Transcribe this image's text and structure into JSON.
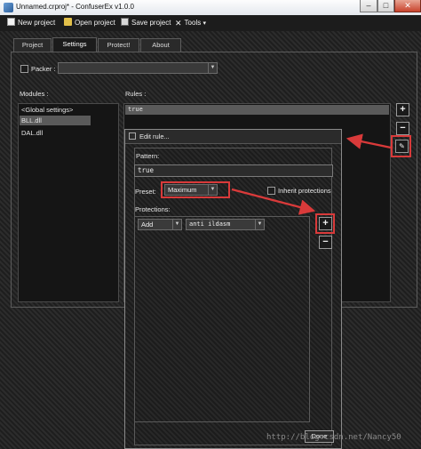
{
  "window": {
    "title": "Unnamed.crproj* - ConfuserEx v1.0.0",
    "minimize": "–",
    "maximize": "□",
    "close": "✕"
  },
  "toolbar": {
    "new_project": "New project",
    "open_project": "Open project",
    "save_project": "Save project",
    "tools": "Tools",
    "tools_caret": "▾"
  },
  "tabs": [
    "Project",
    "Settings",
    "Protect!",
    "About"
  ],
  "settings": {
    "packer_label": "Packer :",
    "modules_label": "Modules :",
    "rules_label": "Rules :",
    "modules": [
      "<Global settings>",
      "BLL.dll",
      "DAL.dll"
    ],
    "rules": [
      "true"
    ]
  },
  "buttons": {
    "add": "+",
    "remove": "−"
  },
  "dialog": {
    "title": "Edit rule...",
    "pattern_label": "Pattern:",
    "pattern_value": "true",
    "preset_label": "Preset:",
    "preset_value": "Maximum",
    "inherit_label": "Inherit protections",
    "protections_label": "Protections:",
    "action_value": "Add",
    "protection_value": "anti ildasm",
    "done": "Done"
  },
  "watermark": "http://blog.csdn.net/Nancy50",
  "colors": {
    "annotation": "#d93a3a",
    "selection": "#5a5a5a",
    "background": "#232323"
  },
  "icons": [
    "app-icon",
    "new-project-icon",
    "open-folder-icon",
    "save-icon",
    "tools-icon",
    "edit-icon",
    "dialog-icon"
  ]
}
